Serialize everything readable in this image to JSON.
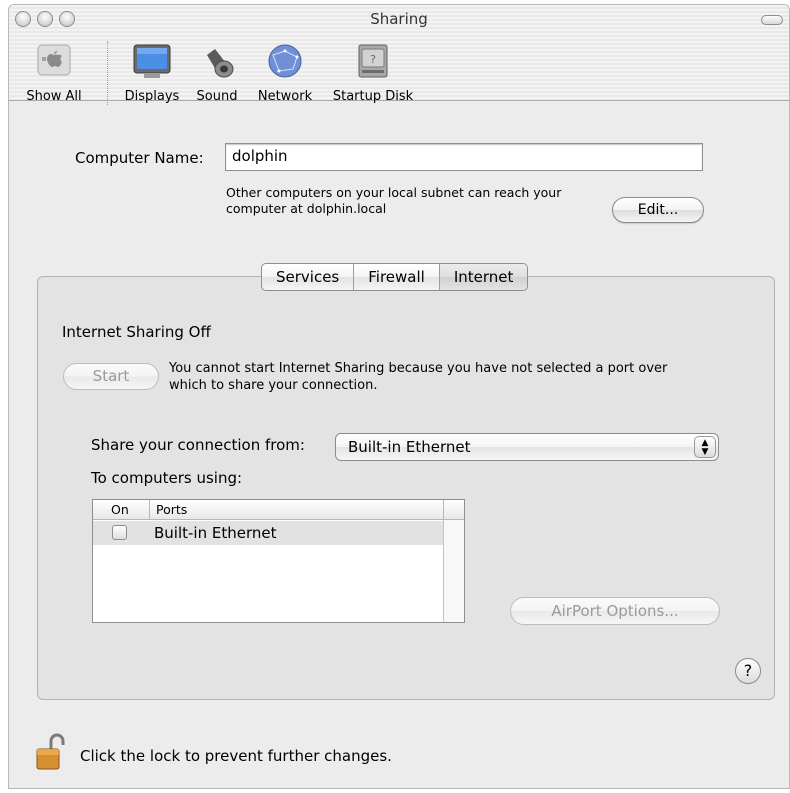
{
  "window": {
    "title": "Sharing"
  },
  "toolbar": {
    "items": [
      {
        "label": "Show All",
        "icon": "apple-grid-icon"
      },
      {
        "label": "Displays",
        "icon": "display-icon"
      },
      {
        "label": "Sound",
        "icon": "speaker-icon"
      },
      {
        "label": "Network",
        "icon": "globe-icon"
      },
      {
        "label": "Startup Disk",
        "icon": "hard-disk-icon"
      }
    ]
  },
  "computer_name": {
    "label": "Computer Name:",
    "value": "dolphin",
    "info": "Other computers on your local subnet can reach your computer at dolphin.local",
    "info_line1": "Other computers on your local subnet can reach your",
    "info_line2": "computer at dolphin.local",
    "edit_button": "Edit..."
  },
  "tabs": [
    {
      "label": "Services",
      "active": false
    },
    {
      "label": "Firewall",
      "active": false
    },
    {
      "label": "Internet",
      "active": true
    }
  ],
  "internet": {
    "status": "Internet Sharing Off",
    "start_button": "Start",
    "message_line1": "You cannot start Internet Sharing because you have not selected a port over",
    "message_line2": "which to share your connection.",
    "share_from_label": "Share your connection from:",
    "share_from_value": "Built-in Ethernet",
    "to_computers_label": "To computers using:",
    "table": {
      "headers": [
        "On",
        "Ports"
      ],
      "rows": [
        {
          "on": false,
          "port": "Built-in Ethernet"
        }
      ]
    },
    "airport_button": "AirPort Options...",
    "help_label": "?"
  },
  "footer": {
    "lock_text": "Click the lock to prevent further changes."
  },
  "colors": {
    "window_bg": "#ececec",
    "pane_bg": "#e3e3e3",
    "selected_row": "#e2e2e2",
    "disabled_text": "#9a9a9a"
  }
}
